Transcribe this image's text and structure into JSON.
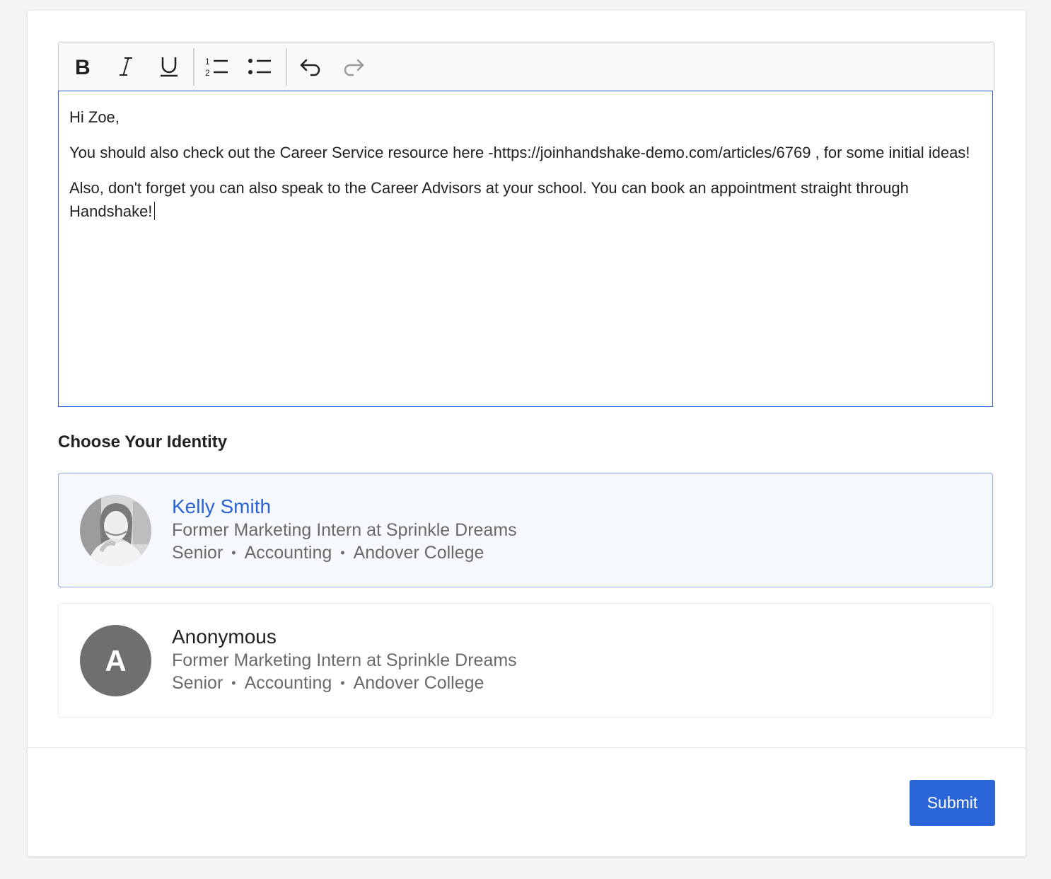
{
  "toolbar": {
    "buttons": [
      {
        "name": "bold-button",
        "icon": "bold-icon"
      },
      {
        "name": "italic-button",
        "icon": "italic-icon"
      },
      {
        "name": "underline-button",
        "icon": "underline-icon"
      },
      {
        "name": "ordered-list-button",
        "icon": "ordered-list-icon"
      },
      {
        "name": "bullet-list-button",
        "icon": "bullet-list-icon"
      },
      {
        "name": "undo-button",
        "icon": "undo-icon"
      },
      {
        "name": "redo-button",
        "icon": "redo-icon"
      }
    ]
  },
  "editor": {
    "paragraphs": [
      "Hi Zoe,",
      "You should also check out the Career Service resource here -https://joinhandshake-demo.com/articles/6769 , for some initial ideas!",
      "Also, don't forget you can also speak to the Career Advisors at your school. You can book an appointment straight through Handshake!"
    ]
  },
  "identity": {
    "title": "Choose Your Identity",
    "options": [
      {
        "name": "Kelly Smith",
        "headline": "Former Marketing Intern at Sprinkle Dreams",
        "year": "Senior",
        "major": "Accounting",
        "school": "Andover College",
        "selected": true
      },
      {
        "name": "Anonymous",
        "avatar_letter": "A",
        "headline": "Former Marketing Intern at Sprinkle Dreams",
        "year": "Senior",
        "major": "Accounting",
        "school": "Andover College",
        "selected": false
      }
    ]
  },
  "footer": {
    "submit_label": "Submit"
  },
  "colors": {
    "accent": "#2b63d4",
    "selected_bg": "#f5f8fc",
    "muted_text": "#6a6a6a"
  }
}
